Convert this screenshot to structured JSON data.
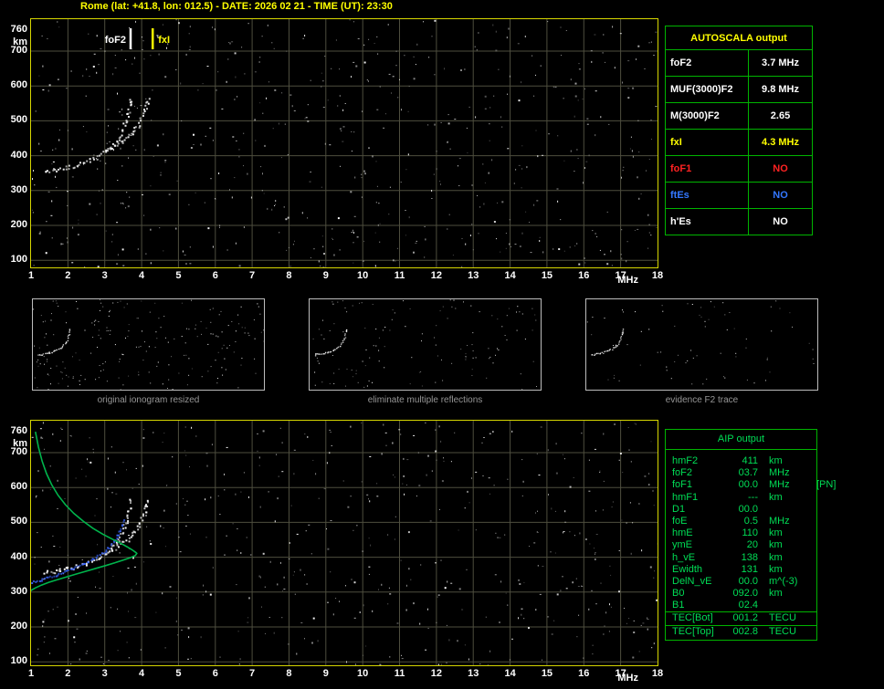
{
  "title": "Rome (lat: +41.8, lon: 012.5) - DATE: 2026 02 21 - TIME (UT): 23:30",
  "colors": {
    "background": "#000000",
    "title_yellow": "#ffff00",
    "plot_border": "#d6d600",
    "grid": "#4e4e3e",
    "table_green": "#00b400",
    "aip_text": "#00dd55",
    "caption_gray": "#969696",
    "trace_white": "#ffffff",
    "restored_blue": "#3a66ff",
    "profile_green": "#00b44c",
    "foF1_red": "#ff2222",
    "ftEs_blue": "#3377ff"
  },
  "autoscala": {
    "header": "AUTOSCALA output",
    "rows": [
      {
        "label": "foF2",
        "value": "3.7 MHz",
        "color": "#ffffff"
      },
      {
        "label": "MUF(3000)F2",
        "value": "9.8 MHz",
        "color": "#ffffff"
      },
      {
        "label": "M(3000)F2",
        "value": "2.65",
        "color": "#ffffff"
      },
      {
        "label": "fxI",
        "value": "4.3 MHz",
        "color": "#ffff00"
      },
      {
        "label": "foF1",
        "value": "NO",
        "color": "#ff2222"
      },
      {
        "label": "ftEs",
        "value": "NO",
        "color": "#3377ff"
      },
      {
        "label": "h'Es",
        "value": "NO",
        "color": "#ffffff"
      }
    ]
  },
  "thumbnails": [
    {
      "caption": "original ionogram resized"
    },
    {
      "caption": "eliminate multiple reflections"
    },
    {
      "caption": "evidence F2 trace"
    }
  ],
  "aip": {
    "header": "AIP output",
    "rows": [
      {
        "label": "hmF2",
        "value": "411",
        "unit": "km",
        "extra": ""
      },
      {
        "label": "foF2",
        "value": "03.7",
        "unit": "MHz",
        "extra": ""
      },
      {
        "label": "foF1",
        "value": "00.0",
        "unit": "MHz",
        "extra": "[PN]"
      },
      {
        "label": "hmF1",
        "value": "---",
        "unit": "km",
        "extra": ""
      },
      {
        "label": "D1",
        "value": "00.0",
        "unit": "",
        "extra": ""
      },
      {
        "label": "foE",
        "value": "0.5",
        "unit": "MHz",
        "extra": ""
      },
      {
        "label": "hmE",
        "value": "110",
        "unit": "km",
        "extra": ""
      },
      {
        "label": "ymE",
        "value": "20",
        "unit": "km",
        "extra": ""
      },
      {
        "label": "h_vE",
        "value": "138",
        "unit": "km",
        "extra": ""
      },
      {
        "label": "Ewidth",
        "value": "131",
        "unit": "km",
        "extra": ""
      },
      {
        "label": "DelN_vE",
        "value": "00.0",
        "unit": "m^(-3)",
        "extra": ""
      },
      {
        "label": "B0",
        "value": "092.0",
        "unit": "km",
        "extra": ""
      },
      {
        "label": "B1",
        "value": "02.4",
        "unit": "",
        "extra": ""
      },
      {
        "label": "TEC[Bot]",
        "value": "001.2",
        "unit": "TECU",
        "extra": "",
        "sep": true
      },
      {
        "label": "TEC[Top]",
        "value": "002.8",
        "unit": "TECU",
        "extra": "",
        "sep": true
      }
    ]
  },
  "chart_data": [
    {
      "type": "scatter",
      "name": "scaled-ionogram",
      "xlabel": "MHz",
      "ylabel": "km",
      "xlim": [
        1,
        18
      ],
      "ylim": [
        80,
        780
      ],
      "x_ticks": [
        1,
        2,
        3,
        4,
        5,
        6,
        7,
        8,
        9,
        10,
        11,
        12,
        13,
        14,
        15,
        16,
        17,
        18
      ],
      "y_ticks": [
        760,
        700,
        600,
        500,
        400,
        300,
        200,
        100
      ],
      "grid": true,
      "markers": [
        {
          "name": "foF2",
          "x": 3.7,
          "color": "#ffffff",
          "side": "left"
        },
        {
          "name": "fxI",
          "x": 4.3,
          "color": "#ffff00",
          "side": "right"
        }
      ],
      "series": [
        {
          "name": "F2-ordinary-trace",
          "style": "dots",
          "color": "#ffffff",
          "points": [
            [
              1.35,
              357
            ],
            [
              1.55,
              360
            ],
            [
              1.75,
              364
            ],
            [
              1.95,
              368
            ],
            [
              2.15,
              373
            ],
            [
              2.35,
              379
            ],
            [
              2.55,
              387
            ],
            [
              2.75,
              397
            ],
            [
              2.95,
              409
            ],
            [
              3.1,
              421
            ],
            [
              3.25,
              436
            ],
            [
              3.38,
              454
            ],
            [
              3.48,
              475
            ],
            [
              3.56,
              500
            ],
            [
              3.62,
              525
            ],
            [
              3.66,
              548
            ],
            [
              3.7,
              570
            ]
          ]
        },
        {
          "name": "F2-extraordinary-trace",
          "style": "dots",
          "color": "#ffffff",
          "points": [
            [
              3.0,
              413
            ],
            [
              3.2,
              425
            ],
            [
              3.4,
              438
            ],
            [
              3.6,
              452
            ],
            [
              3.75,
              468
            ],
            [
              3.88,
              487
            ],
            [
              3.98,
              508
            ],
            [
              4.06,
              530
            ],
            [
              4.12,
              552
            ],
            [
              4.16,
              572
            ]
          ]
        }
      ]
    },
    {
      "type": "scatter",
      "name": "ionogram-with-restored-trace-and-profile",
      "xlabel": "MHz",
      "ylabel": "km",
      "xlim": [
        1,
        18
      ],
      "ylim": [
        80,
        780
      ],
      "x_ticks": [
        1,
        2,
        3,
        4,
        5,
        6,
        7,
        8,
        9,
        10,
        11,
        12,
        13,
        14,
        15,
        16,
        17,
        18
      ],
      "y_ticks": [
        760,
        700,
        600,
        500,
        400,
        300,
        200,
        100
      ],
      "grid": true,
      "markers": [],
      "series": [
        {
          "name": "F2-ordinary-trace",
          "style": "dots",
          "color": "#ffffff",
          "points": [
            [
              1.35,
              357
            ],
            [
              1.55,
              360
            ],
            [
              1.75,
              364
            ],
            [
              1.95,
              368
            ],
            [
              2.15,
              373
            ],
            [
              2.35,
              379
            ],
            [
              2.55,
              387
            ],
            [
              2.75,
              397
            ],
            [
              2.95,
              409
            ],
            [
              3.1,
              421
            ],
            [
              3.25,
              436
            ],
            [
              3.38,
              454
            ],
            [
              3.48,
              475
            ],
            [
              3.56,
              500
            ],
            [
              3.62,
              525
            ],
            [
              3.66,
              548
            ],
            [
              3.7,
              570
            ]
          ]
        },
        {
          "name": "F2-extraordinary-trace",
          "style": "dots",
          "color": "#ffffff",
          "points": [
            [
              3.0,
              413
            ],
            [
              3.2,
              425
            ],
            [
              3.4,
              438
            ],
            [
              3.6,
              452
            ],
            [
              3.75,
              468
            ],
            [
              3.88,
              487
            ],
            [
              3.98,
              508
            ],
            [
              4.06,
              530
            ],
            [
              4.12,
              552
            ],
            [
              4.16,
              572
            ]
          ]
        },
        {
          "name": "restored-trace",
          "style": "dots",
          "color": "#3a66ff",
          "points": [
            [
              1.0,
              331
            ],
            [
              1.2,
              336
            ],
            [
              1.4,
              342
            ],
            [
              1.6,
              348
            ],
            [
              1.8,
              355
            ],
            [
              2.0,
              363
            ],
            [
              2.2,
              372
            ],
            [
              2.4,
              382
            ],
            [
              2.6,
              393
            ],
            [
              2.8,
              405
            ],
            [
              3.0,
              419
            ],
            [
              3.15,
              434
            ],
            [
              3.28,
              452
            ],
            [
              3.38,
              473
            ],
            [
              3.46,
              496
            ],
            [
              3.5,
              512
            ]
          ]
        },
        {
          "name": "electron-density-profile",
          "style": "line",
          "color": "#00b44c",
          "points": [
            [
              1.12,
              760
            ],
            [
              1.2,
              716
            ],
            [
              1.3,
              676
            ],
            [
              1.42,
              640
            ],
            [
              1.56,
              608
            ],
            [
              1.73,
              578
            ],
            [
              1.93,
              551
            ],
            [
              2.16,
              526
            ],
            [
              2.42,
              503
            ],
            [
              2.68,
              483
            ],
            [
              2.95,
              466
            ],
            [
              3.2,
              452
            ],
            [
              3.45,
              439
            ],
            [
              3.62,
              429
            ],
            [
              3.76,
              420
            ],
            [
              3.84,
              414
            ],
            [
              3.87,
              411
            ],
            [
              3.83,
              405
            ],
            [
              3.7,
              399
            ],
            [
              3.5,
              392
            ],
            [
              3.27,
              384
            ],
            [
              3.02,
              376
            ],
            [
              2.76,
              368
            ],
            [
              2.5,
              360
            ],
            [
              2.24,
              352
            ],
            [
              1.98,
              344
            ],
            [
              1.73,
              336
            ],
            [
              1.48,
              328
            ],
            [
              1.28,
              320
            ],
            [
              1.12,
              312
            ],
            [
              1.0,
              305
            ],
            [
              0.96,
              300
            ]
          ]
        }
      ]
    }
  ]
}
